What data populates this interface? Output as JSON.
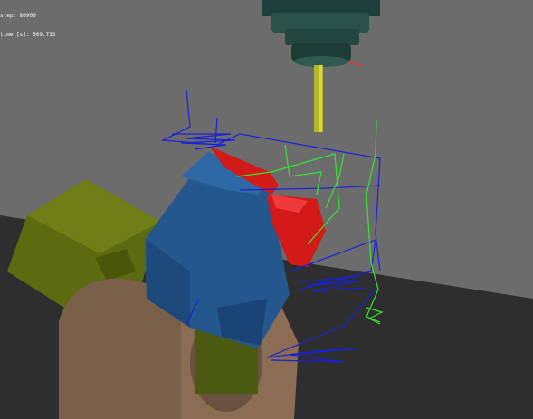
{
  "hud": {
    "step_line": "step: 80900",
    "time_line": "time [s]: 509.733"
  },
  "colors": {
    "background": "#6c6c6c",
    "floor": "#2e2e2e",
    "spindle": "#234a42",
    "tool": "#b5b52a",
    "part_blue": "#24578d",
    "part_red": "#d41919",
    "fixture_olive": "#5c6a10",
    "base_brown": "#7a6048",
    "toolpath_blue": "#1a22d8",
    "toolpath_green": "#34e634"
  }
}
